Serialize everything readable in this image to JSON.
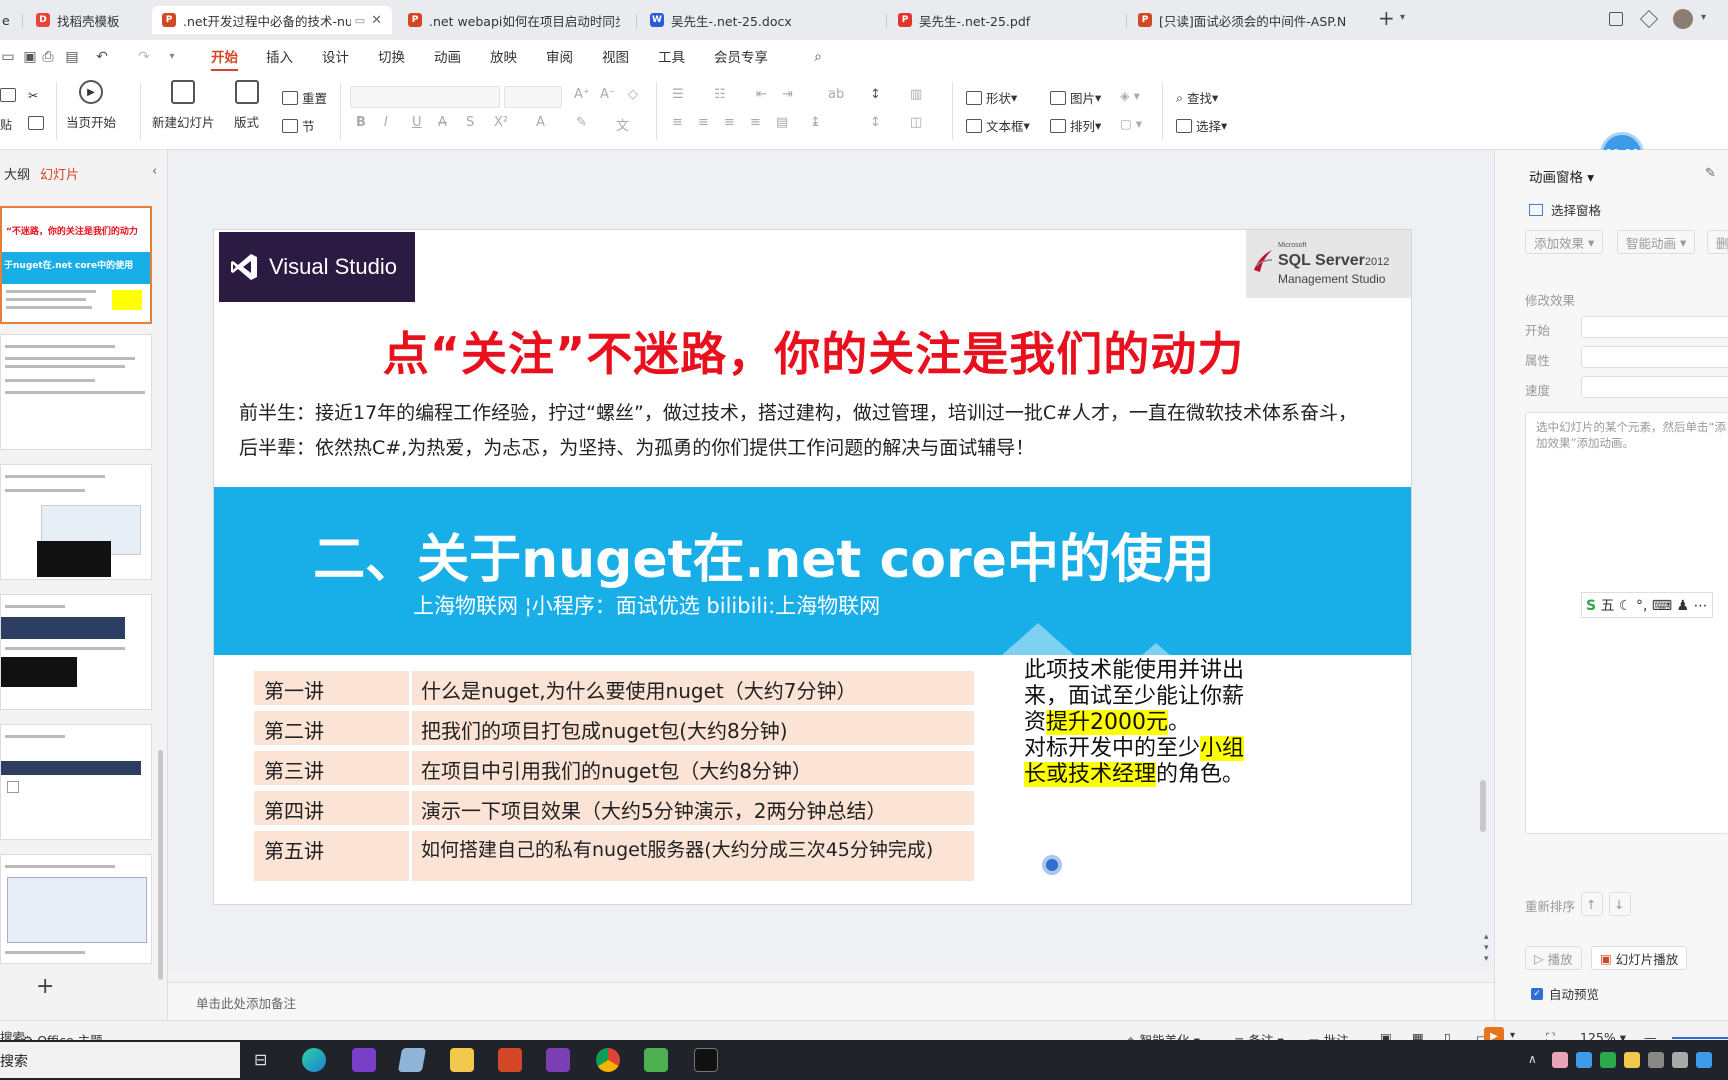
{
  "tabs": [
    {
      "label": "e",
      "color": "#e8443a"
    },
    {
      "label": "找稻壳模板",
      "color": "#e8443a"
    },
    {
      "label": ".net开发过程中必备的技术-nu",
      "color": "#d24726",
      "active": true
    },
    {
      "label": ".net webapi如何在项目启动时同步启",
      "color": "#d24726"
    },
    {
      "label": "吴先生-.net-25.docx",
      "color": "#2b5cd8"
    },
    {
      "label": "吴先生-.net-25.pdf",
      "color": "#e3342f"
    },
    {
      "label": "[只读]面试必须会的中间件-ASP.NET",
      "color": "#d24726"
    }
  ],
  "tab_add": "+",
  "menu": [
    "开始",
    "插入",
    "设计",
    "切换",
    "动画",
    "放映",
    "审阅",
    "视图",
    "工具",
    "会员专享"
  ],
  "ribbon": {
    "play_from_current": "当页开始",
    "new_slide": "新建幻灯片",
    "layout": "版式",
    "reset": "重置",
    "section": "节",
    "shape": "形状",
    "picture": "图片",
    "textbox": "文本框",
    "arrange": "排列",
    "find": "查找",
    "select": "选择"
  },
  "left_panel": {
    "tab_outline": "大纲",
    "tab_slides": "幻灯片",
    "add": "+"
  },
  "slide": {
    "vs_name": "Visual Studio",
    "sql_ms": "Microsoft",
    "sql_name": "SQL Server",
    "sql_year": "2012",
    "sql_mgmt": "Management Studio",
    "title": "点“关注”不迷路，你的关注是我们的动力",
    "intro1": "前半生：接近17年的编程工作经验，拧过“螺丝”，做过技术，搭过建构，做过管理，培训过一批C#人才，一直在微软技术体系奋斗，",
    "intro2": "后半辈：依然热C#,为热爱，为忐忑，为坚持、为孤勇的你们提供工作问题的解决与面试辅导！",
    "banner_title": "二、关于nuget在.net core中的使用",
    "banner_sub": "上海物联网  ¦小程序：面试优选  bilibili:上海物联网",
    "lectures": [
      {
        "num": "第一讲",
        "text": "什么是nuget,为什么要使用nuget（大约7分钟）"
      },
      {
        "num": "第二讲",
        "text": "把我们的项目打包成nuget包(大约8分钟)"
      },
      {
        "num": "第三讲",
        "text": "在项目中引用我们的nuget包（大约8分钟）"
      },
      {
        "num": "第四讲",
        "text": "演示一下项目效果（大约5分钟演示，2两分钟总结）"
      },
      {
        "num": "第五讲",
        "text": "如何搭建自己的私有nuget服务器(大约分成三次45分钟完成)"
      }
    ],
    "callout_a": "此项技术能使用并讲出来，面试至少能让你薪资",
    "callout_hl1": "提升2000元",
    "callout_b": "。",
    "callout_c": "对标开发中的至少",
    "callout_hl2": "小组长或技术经理",
    "callout_d": "的角色。"
  },
  "notes_placeholder": "单击此处添加备注",
  "timer": "00:00",
  "right_panel": {
    "title": "动画窗格",
    "select_pane": "选择窗格",
    "add_effect": "添加效果",
    "smart_anim": "智能动画",
    "delete": "删",
    "modify_effect": "修改效果",
    "start": "开始",
    "property": "属性",
    "speed": "速度",
    "hint": "选中幻灯片的某个元素，然后单击“添加效果”添加动画。",
    "reorder": "重新排序",
    "play": "播放",
    "slideshow": "幻灯片播放",
    "auto_preview": "自动预览"
  },
  "ime_bar": "五",
  "status": {
    "theme": "Office 主题",
    "smart_beautify": "智能美化",
    "notes": "备注",
    "comments": "批注",
    "zoom": "125%"
  },
  "taskbar_search": "搜索",
  "colors": {
    "accent": "#d24726",
    "banner": "#18aee8",
    "title_red": "#e8101d",
    "row_fill": "#fbe4d5",
    "highlight": "#ffff00"
  }
}
